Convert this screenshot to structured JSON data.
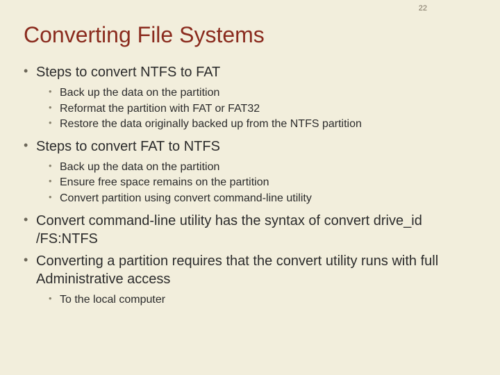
{
  "page_number": "22",
  "title": "Converting File Systems",
  "bullets": [
    {
      "text": "Steps to convert NTFS to FAT",
      "sub": [
        "Back up the data on the partition",
        "Reformat the partition with FAT or FAT32",
        "Restore the data originally backed up from the NTFS partition"
      ]
    },
    {
      "text": "Steps to convert FAT to NTFS",
      "sub": [
        "Back up the data on the partition",
        "Ensure free space remains on the partition",
        "Convert partition using convert command-line utility"
      ]
    },
    {
      "text": "Convert command-line utility has the syntax of convert drive_id /FS:NTFS",
      "sub": []
    },
    {
      "text": "Converting a partition requires that the convert utility runs with full Administrative access",
      "sub": [
        "To the local computer"
      ]
    }
  ]
}
